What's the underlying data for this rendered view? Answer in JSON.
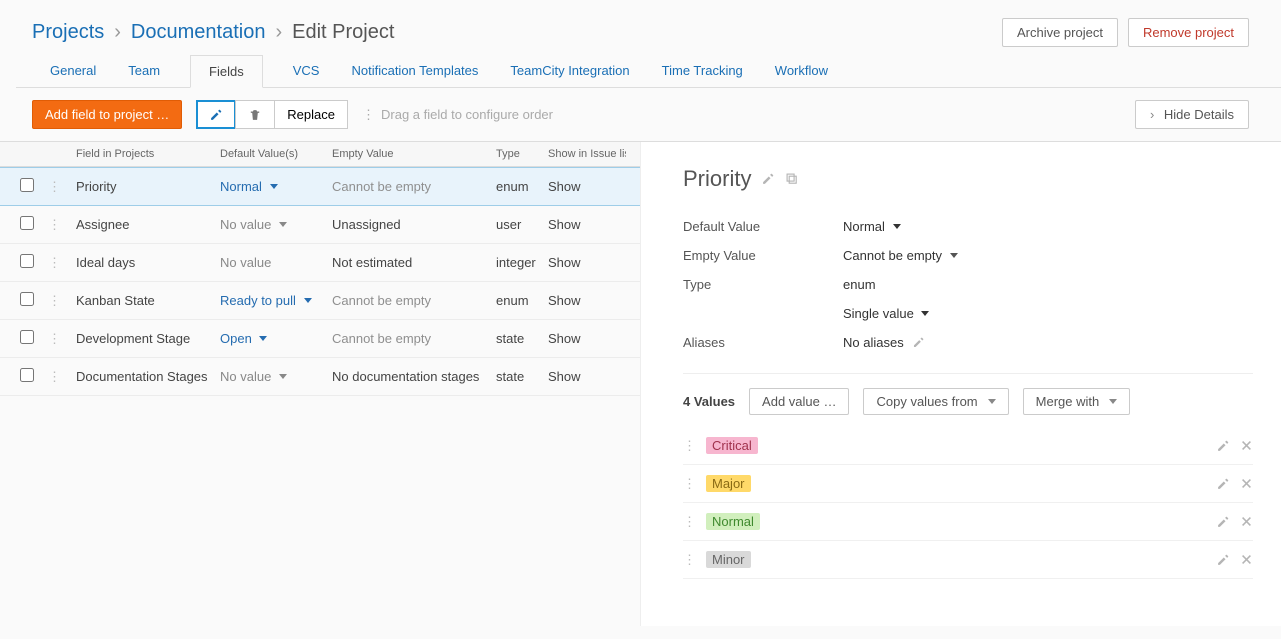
{
  "breadcrumb": {
    "projects": "Projects",
    "doc": "Documentation",
    "edit": "Edit Project"
  },
  "hdr_buttons": {
    "archive": "Archive project",
    "remove": "Remove project"
  },
  "tabs": {
    "general": "General",
    "team": "Team",
    "fields": "Fields",
    "vcs": "VCS",
    "notif": "Notification Templates",
    "teamcity": "TeamCity Integration",
    "time": "Time Tracking",
    "workflow": "Workflow"
  },
  "toolbar": {
    "add_field": "Add field to project …",
    "replace": "Replace",
    "drag_hint": "Drag a field to configure order",
    "hide_details": "Hide Details"
  },
  "table": {
    "headers": {
      "name": "Field in Projects",
      "def": "Default Value(s)",
      "emp": "Empty Value",
      "type": "Type",
      "show": "Show in Issue list"
    },
    "rows": [
      {
        "name": "Priority",
        "def": "Normal",
        "def_link": true,
        "def_caret": true,
        "emp": "Cannot be empty",
        "emp_muted": true,
        "type": "enum",
        "show": "Show",
        "selected": true
      },
      {
        "name": "Assignee",
        "def": "No value",
        "def_link": true,
        "def_novalue": true,
        "def_caret": true,
        "emp": "Unassigned",
        "emp_muted": false,
        "type": "user",
        "show": "Show"
      },
      {
        "name": "Ideal days",
        "def": "No value",
        "def_novalue": true,
        "def_caret": false,
        "emp": "Not estimated",
        "emp_muted": false,
        "type": "integer",
        "show": "Show"
      },
      {
        "name": "Kanban State",
        "def": "Ready to pull",
        "def_link": true,
        "def_caret": true,
        "emp": "Cannot be empty",
        "emp_muted": true,
        "type": "enum",
        "show": "Show"
      },
      {
        "name": "Development Stage",
        "def": "Open",
        "def_link": true,
        "def_caret": true,
        "emp": "Cannot be empty",
        "emp_muted": true,
        "type": "state",
        "show": "Show"
      },
      {
        "name": "Documentation Stages",
        "def": "No value",
        "def_link": true,
        "def_novalue": true,
        "def_caret": true,
        "emp": "No documentation stages",
        "emp_muted": false,
        "type": "state",
        "show": "Show"
      }
    ]
  },
  "panel": {
    "title": "Priority",
    "default_label": "Default Value",
    "default_value": "Normal",
    "empty_label": "Empty Value",
    "empty_value": "Cannot be empty",
    "type_label": "Type",
    "type_value": "enum",
    "single_value": "Single value",
    "aliases_label": "Aliases",
    "aliases_value": "No aliases",
    "values_count": "4 Values",
    "add_value": "Add value …",
    "copy_values": "Copy values from",
    "merge": "Merge with",
    "values": [
      {
        "label": "Critical",
        "bg": "#f7b6cf",
        "fg": "#a0324d"
      },
      {
        "label": "Major",
        "bg": "#ffd969",
        "fg": "#8a6a14"
      },
      {
        "label": "Normal",
        "bg": "#d1efbd",
        "fg": "#3f8a2e"
      },
      {
        "label": "Minor",
        "bg": "#d9d9d9",
        "fg": "#666666"
      }
    ]
  }
}
